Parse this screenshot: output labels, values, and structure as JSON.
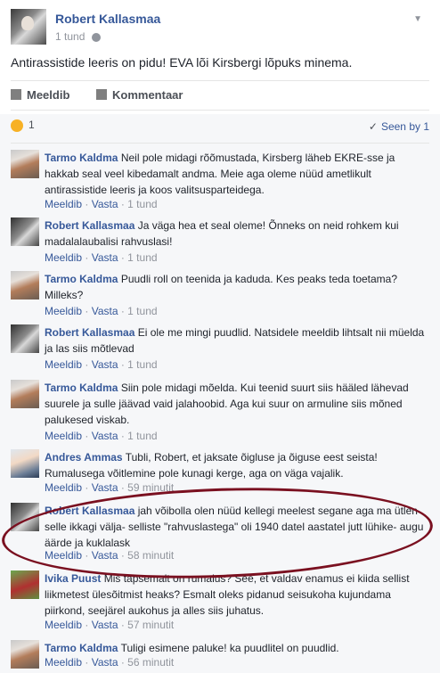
{
  "post": {
    "author": "Robert Kallasmaa",
    "time": "1 tund",
    "text": "Antirassistide leeris on pidu! EVA lõi Kirsbergi lõpuks minema."
  },
  "actions": {
    "like": "Meeldib",
    "comment": "Kommentaar"
  },
  "reactions": {
    "count": "1",
    "seen": "Seen by 1"
  },
  "comments": [
    {
      "author": "Tarmo Kaldma",
      "text": "Neil pole midagi rõõmustada, Kirsberg läheb EKRE-sse ja hakkab seal veel kibedamalt andma. Meie aga oleme nüüd ametlikult antirassistide leeris ja koos valitsusparteidega.",
      "like": "Meeldib",
      "reply": "Vasta",
      "time": "1 tund"
    },
    {
      "author": "Robert Kallasmaa",
      "text": "Ja väga hea et seal oleme! Õnneks on neid rohkem kui madalalaubalisi rahvuslasi!",
      "like": "Meeldib",
      "reply": "Vasta",
      "time": "1 tund"
    },
    {
      "author": "Tarmo Kaldma",
      "text": "Puudli roll on teenida ja kaduda. Kes peaks teda toetama? Milleks?",
      "like": "Meeldib",
      "reply": "Vasta",
      "time": "1 tund"
    },
    {
      "author": "Robert Kallasmaa",
      "text": "Ei ole me mingi puudlid. Natsidele meeldib lihtsalt nii müelda ja las siis mõtlevad",
      "like": "Meeldib",
      "reply": "Vasta",
      "time": "1 tund"
    },
    {
      "author": "Tarmo Kaldma",
      "text": "Siin pole midagi mõelda. Kui teenid suurt siis hääled lähevad suurele ja sulle jäävad vaid jalahoobid. Aga kui suur on armuline siis mõned palukesed viskab.",
      "like": "Meeldib",
      "reply": "Vasta",
      "time": "1 tund"
    },
    {
      "author": "Andres Ammas",
      "text": "Tubli, Robert, et jaksate õigluse ja õiguse eest seista! Rumalusega võitlemine pole kunagi kerge, aga on väga vajalik.",
      "like": "Meeldib",
      "reply": "Vasta",
      "time": "59 minutit"
    },
    {
      "author": "Robert Kallasmaa",
      "text": "jah võibolla olen nüüd kellegi meelest segane aga ma ütlen selle ikkagi välja- selliste \"rahvuslastega\" oli 1940 datel aastatel jutt lühike- augu äärde ja kuklalask",
      "like": "Meeldib",
      "reply": "Vasta",
      "time": "58 minutit"
    },
    {
      "author": "Ivika Puust",
      "text": "Mis tapsemalt on rumalus? See, et valdav enamus ei kiida sellist liikmetest ülesõitmist heaks? Esmalt oleks pidanud seisukoha kujundama piirkond, seejärel aukohus ja alles siis juhatus.",
      "like": "Meeldib",
      "reply": "Vasta",
      "time": "57 minutit"
    },
    {
      "author": "Tarmo Kaldma",
      "text": "Tuligi esimene paluke! ka puudlitel on puudlid.",
      "like": "Meeldib",
      "reply": "Vasta",
      "time": "56 minutit"
    }
  ],
  "colors": {
    "link": "#365899",
    "meta": "#90949c",
    "highlight_ring": "#7a1020"
  }
}
